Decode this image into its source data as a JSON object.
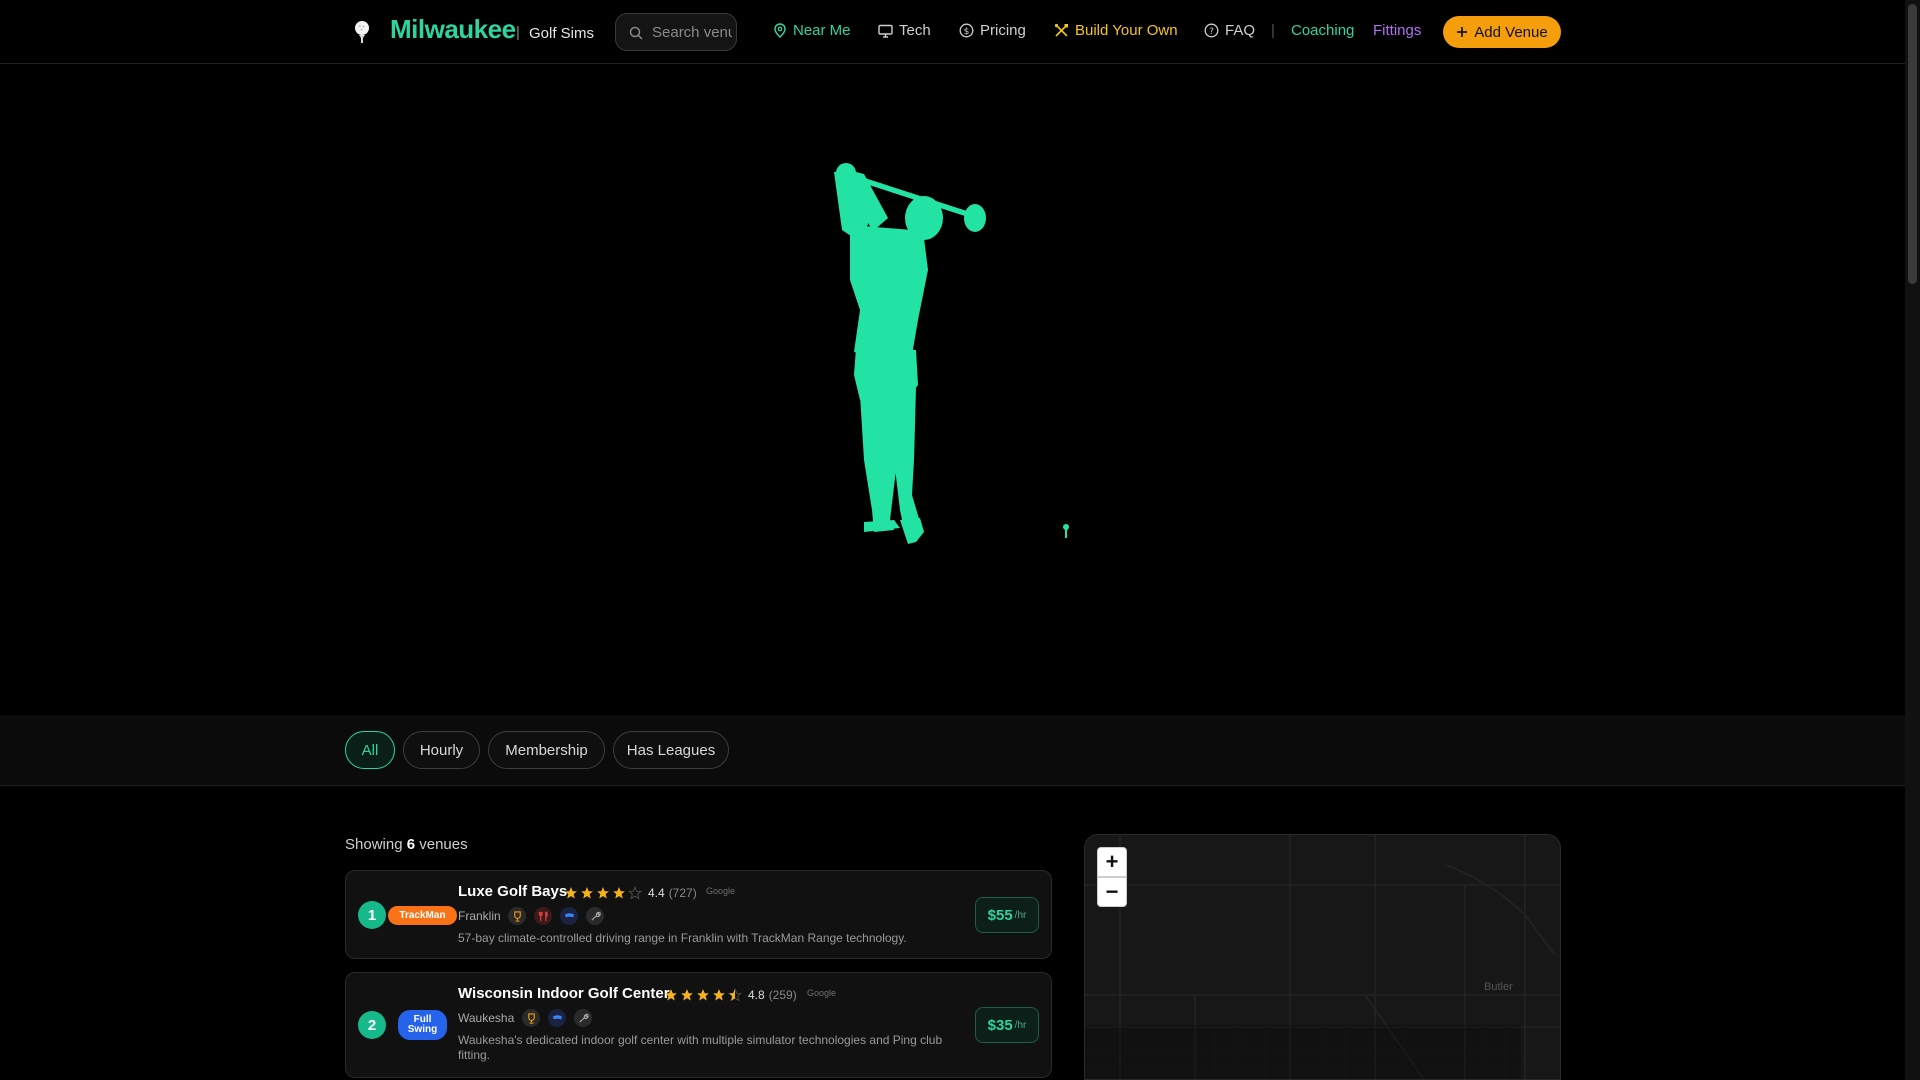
{
  "header": {
    "brand": "Milwaukee",
    "separator": "|",
    "subtitle": "Golf Sims",
    "search_placeholder": "Search venues",
    "nav": {
      "near_me": "Near Me",
      "tech": "Tech",
      "pricing": "Pricing",
      "build": "Build Your Own",
      "faq": "FAQ",
      "divider": "|",
      "coaching": "Coaching",
      "fittings": "Fittings"
    },
    "add_venue": "Add Venue"
  },
  "colors": {
    "accent": "#2dd4a0",
    "build": "#f5c518",
    "fittings": "#b06ef0",
    "add_button": "#f59e0b",
    "trackman": "#f97316",
    "fullswing": "#2563eb"
  },
  "filters": [
    "All",
    "Hourly",
    "Membership",
    "Has Leagues"
  ],
  "active_filter": "All",
  "results": {
    "prefix": "Showing",
    "count": "6",
    "suffix": "venues"
  },
  "venues": [
    {
      "rank": "1",
      "tech": "TrackMan",
      "name": "Luxe Golf Bays",
      "stars": 4.4,
      "rating": "4.4",
      "reviews": "(727)",
      "source": "Google",
      "city": "Franklin",
      "amenities": [
        "trophy-icon",
        "utensils-icon",
        "shield-icon",
        "wrench-icon"
      ],
      "description": "57-bay climate-controlled driving range in Franklin with TrackMan Range technology.",
      "price": "$55",
      "unit": "/hr"
    },
    {
      "rank": "2",
      "tech_line1": "Full",
      "tech_line2": "Swing",
      "name": "Wisconsin Indoor Golf Center",
      "stars": 4.8,
      "rating": "4.8",
      "reviews": "(259)",
      "source": "Google",
      "city": "Waukesha",
      "amenities": [
        "trophy-icon",
        "shield-icon",
        "wrench-icon"
      ],
      "description": "Waukesha's dedicated indoor golf center with multiple simulator technologies and Ping club fitting.",
      "price": "$35",
      "unit": "/hr"
    }
  ],
  "map": {
    "zoom_in": "+",
    "zoom_out": "−",
    "place_label": "Butler"
  }
}
